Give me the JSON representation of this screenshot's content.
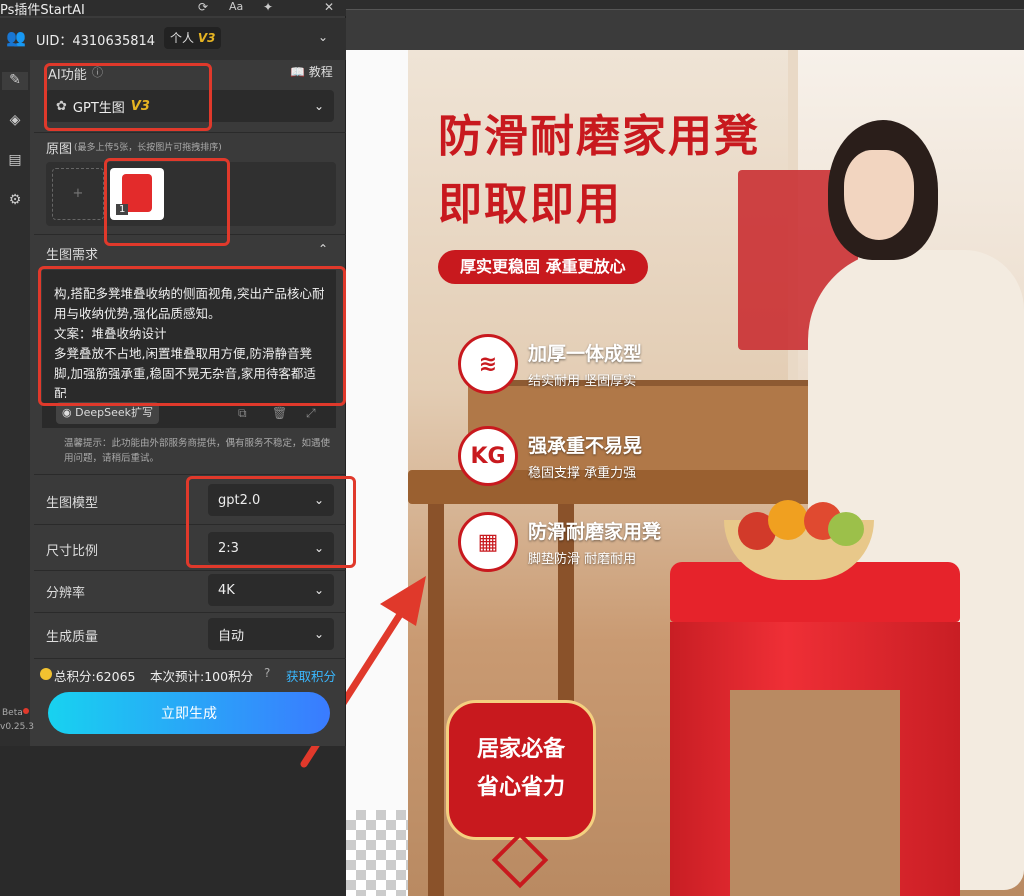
{
  "plugin": {
    "title": "Ps插件StartAI",
    "uid_label": "UID：4310635814",
    "account_type": "个人",
    "version_tag": "V3",
    "beta": "Beta",
    "version_number": "v0.25.3",
    "ai_feature_label": "AI功能",
    "tutorial_label": "教程",
    "feature_select": {
      "label": "GPT生图",
      "tag": "V3"
    },
    "source_image_label": "原图",
    "source_image_hint": "(最多上传5张，长按图片可拖拽排序)",
    "thumb_index": "1",
    "requirement_label": "生图需求",
    "prompt_text": "构,搭配多凳堆叠收纳的侧面视角,突出产品核心耐用与收纳优势,强化品质感知。\n文案：堆叠收纳设计\n多凳叠放不占地,闲置堆叠取用方便,防滑静音凳脚,加强筋强承重,稳固不晃无杂音,家用待客都适配",
    "deepseek_label": "DeepSeek扩写",
    "notice": "温馨提示：此功能由外部服务商提供，偶有服务不稳定，如遇使用问题，请稍后重试。",
    "model": {
      "label": "生图模型",
      "value": "gpt2.0"
    },
    "ratio": {
      "label": "尺寸比例",
      "value": "2:3"
    },
    "resolution": {
      "label": "分辨率",
      "value": "4K"
    },
    "quality": {
      "label": "生成质量",
      "value": "自动"
    },
    "points_total": "总积分:62065",
    "points_estimate": "本次预计:100积分",
    "get_points": "获取积分",
    "generate_button": "立即生成"
  },
  "artwork": {
    "headline_1": "防滑耐磨家用凳",
    "headline_2": "即取即用",
    "pill": "厚实更稳固 承重更放心",
    "features": [
      {
        "title": "加厚一体成型",
        "subtitle": "结实耐用 坚固厚实"
      },
      {
        "title": "强承重不易晃",
        "subtitle": "稳固支撑 承重力强",
        "icon_text": "KG"
      },
      {
        "title": "防滑耐磨家用凳",
        "subtitle": "脚垫防滑 耐磨耐用"
      }
    ],
    "badge_line_1": "居家必备",
    "badge_line_2": "省心省力"
  },
  "colors": {
    "accent_red": "#c8191e",
    "highlight_box": "#e0392b",
    "button_gradient_start": "#18d2f0",
    "button_gradient_end": "#3a7bff",
    "v3_gold": "#e6b422"
  },
  "icons": [
    "refresh-icon",
    "font-size-icon",
    "pin-icon",
    "close-icon",
    "users-icon",
    "chevron-down-icon",
    "brush-icon",
    "layers-icon",
    "document-icon",
    "gear-icon",
    "info-icon",
    "book-icon",
    "gpt-icon",
    "chevron-up-icon",
    "deepseek-icon",
    "copy-icon",
    "trash-icon",
    "expand-icon",
    "coin-icon",
    "help-icon"
  ]
}
